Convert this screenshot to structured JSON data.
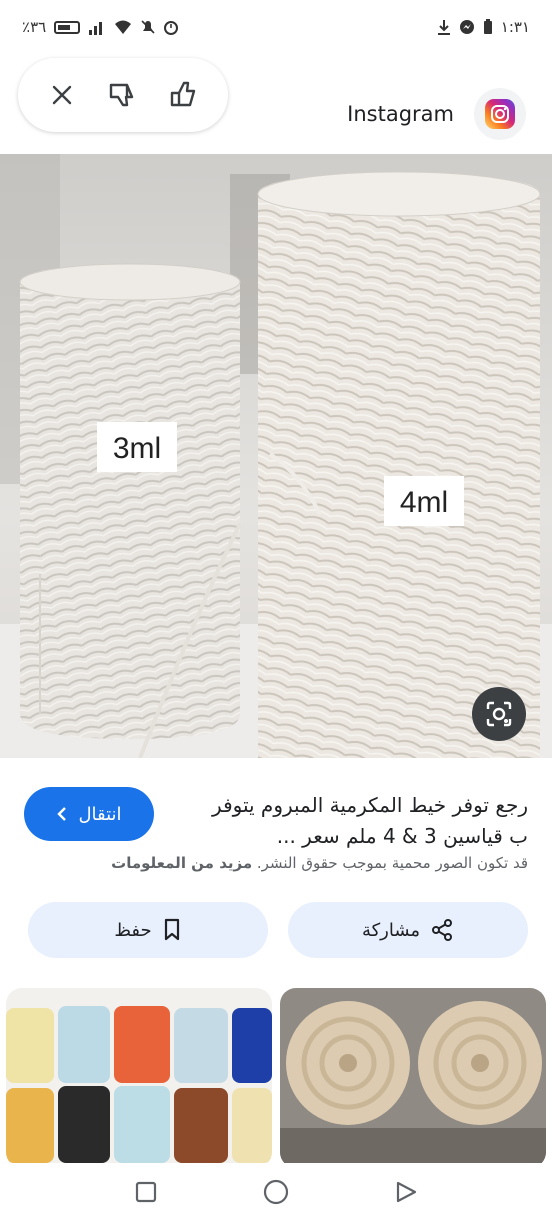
{
  "status_bar": {
    "battery": "٪٣٦",
    "time": "١:٣١"
  },
  "source": {
    "name": "Instagram"
  },
  "main_image": {
    "left_label": "3ml",
    "right_label": "4ml"
  },
  "result": {
    "title": "رجع توفر خيط المكرمية المبروم يتوفر ب قياسين 3 & 4 ملم سعر ...",
    "visit_label": "انتقال",
    "copyright_text": "قد تكون الصور محمية بموجب حقوق النشر.",
    "more_info": "مزيد من المعلومات"
  },
  "actions": {
    "share_label": "مشاركة",
    "save_label": "حفظ"
  },
  "colors": {
    "accent": "#1a73e8",
    "action_bg": "#e8f0fe"
  }
}
